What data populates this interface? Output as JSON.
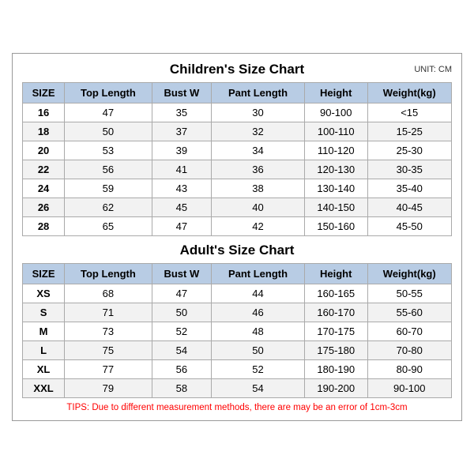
{
  "chart": {
    "unit": "UNIT: CM",
    "children": {
      "title": "Children's Size Chart",
      "headers": [
        "SIZE",
        "Top Length",
        "Bust W",
        "Pant Length",
        "Height",
        "Weight(kg)"
      ],
      "rows": [
        [
          "16",
          "47",
          "35",
          "30",
          "90-100",
          "<15"
        ],
        [
          "18",
          "50",
          "37",
          "32",
          "100-110",
          "15-25"
        ],
        [
          "20",
          "53",
          "39",
          "34",
          "110-120",
          "25-30"
        ],
        [
          "22",
          "56",
          "41",
          "36",
          "120-130",
          "30-35"
        ],
        [
          "24",
          "59",
          "43",
          "38",
          "130-140",
          "35-40"
        ],
        [
          "26",
          "62",
          "45",
          "40",
          "140-150",
          "40-45"
        ],
        [
          "28",
          "65",
          "47",
          "42",
          "150-160",
          "45-50"
        ]
      ]
    },
    "adults": {
      "title": "Adult's Size Chart",
      "headers": [
        "SIZE",
        "Top Length",
        "Bust W",
        "Pant Length",
        "Height",
        "Weight(kg)"
      ],
      "rows": [
        [
          "XS",
          "68",
          "47",
          "44",
          "160-165",
          "50-55"
        ],
        [
          "S",
          "71",
          "50",
          "46",
          "160-170",
          "55-60"
        ],
        [
          "M",
          "73",
          "52",
          "48",
          "170-175",
          "60-70"
        ],
        [
          "L",
          "75",
          "54",
          "50",
          "175-180",
          "70-80"
        ],
        [
          "XL",
          "77",
          "56",
          "52",
          "180-190",
          "80-90"
        ],
        [
          "XXL",
          "79",
          "58",
          "54",
          "190-200",
          "90-100"
        ]
      ]
    },
    "tips": "TIPS: Due to different measurement methods, there are may be an error of 1cm-3cm"
  }
}
